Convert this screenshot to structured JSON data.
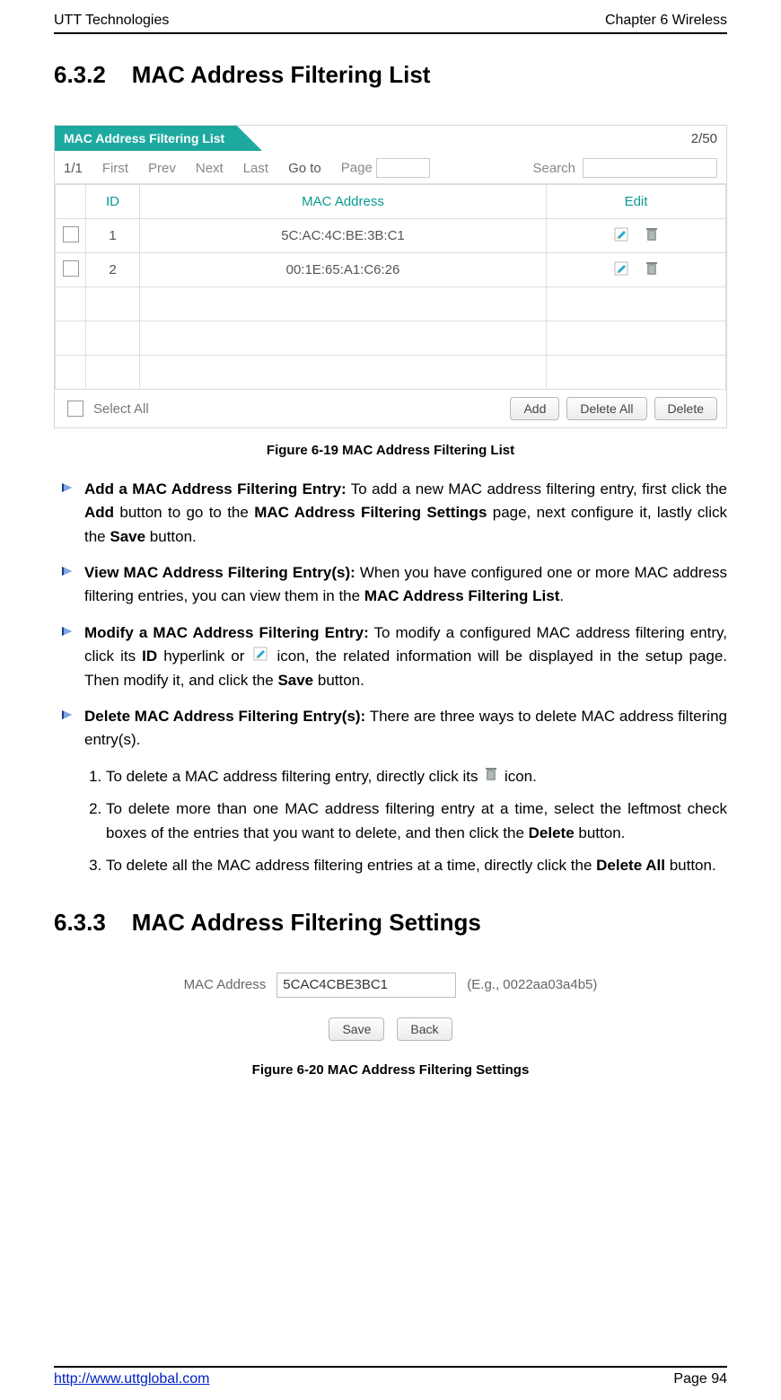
{
  "header": {
    "left": "UTT Technologies",
    "right": "Chapter 6 Wireless"
  },
  "footer": {
    "left": "http://www.uttglobal.com",
    "right": "Page 94"
  },
  "section1": {
    "number": "6.3.2",
    "title": "MAC Address Filtering List"
  },
  "section2": {
    "number": "6.3.3",
    "title": "MAC Address Filtering Settings"
  },
  "panel": {
    "tab": "MAC Address Filtering List",
    "count": "2/50",
    "pager": {
      "pages": "1/1",
      "first": "First",
      "prev": "Prev",
      "next": "Next",
      "last": "Last",
      "goto": "Go to",
      "pageLabel": "Page",
      "search": "Search"
    },
    "headers": {
      "id": "ID",
      "mac": "MAC Address",
      "edit": "Edit"
    },
    "rows": [
      {
        "id": "1",
        "mac": "5C:AC:4C:BE:3B:C1"
      },
      {
        "id": "2",
        "mac": "00:1E:65:A1:C6:26"
      }
    ],
    "footer": {
      "selectAll": "Select All",
      "add": "Add",
      "deleteAll": "Delete All",
      "delete": "Delete"
    }
  },
  "caption1": "Figure 6-19 MAC Address Filtering List",
  "caption2": "Figure 6-20 MAC Address Filtering Settings",
  "bullets": {
    "add": {
      "title": "Add a MAC Address Filtering Entry:",
      "body_a": " To add a new MAC address filtering entry, first click the ",
      "add_b": "Add",
      "body_b": " button to go to the ",
      "page_b": "MAC Address Filtering Settings",
      "body_c": " page, next configure it, lastly click the ",
      "save_b": "Save",
      "body_d": " button."
    },
    "view": {
      "title": "View MAC Address Filtering Entry(s):",
      "body_a": " When you have configured one or more MAC address filtering entries, you can view them in the ",
      "list_b": "MAC Address Filtering List",
      "body_b": "."
    },
    "modify": {
      "title": "Modify a MAC Address Filtering Entry:",
      "body_a": " To modify a configured MAC address filtering entry, click its ",
      "id_b": "ID",
      "body_b": " hyperlink or ",
      "body_c": " icon, the related information will be displayed in the setup page. Then modify it, and click the ",
      "save_b": "Save",
      "body_d": " button."
    },
    "delete": {
      "title": "Delete MAC Address Filtering Entry(s):",
      "body": " There are three ways to delete MAC address filtering entry(s)."
    }
  },
  "steps": {
    "s1_a": "To delete a MAC address filtering entry, directly click its ",
    "s1_b": " icon.",
    "s2_a": "To delete more than one MAC address filtering entry at a time, select the leftmost check boxes of the entries that you want to delete, and then click the ",
    "s2_b": "Delete",
    "s2_c": " button.",
    "s3_a": "To delete all the MAC address filtering entries at a time, directly click the ",
    "s3_b": "Delete All",
    "s3_c": " button."
  },
  "settings": {
    "label": "MAC Address",
    "value": "5CAC4CBE3BC1",
    "hint": "(E.g., 0022aa03a4b5)",
    "save": "Save",
    "back": "Back"
  }
}
